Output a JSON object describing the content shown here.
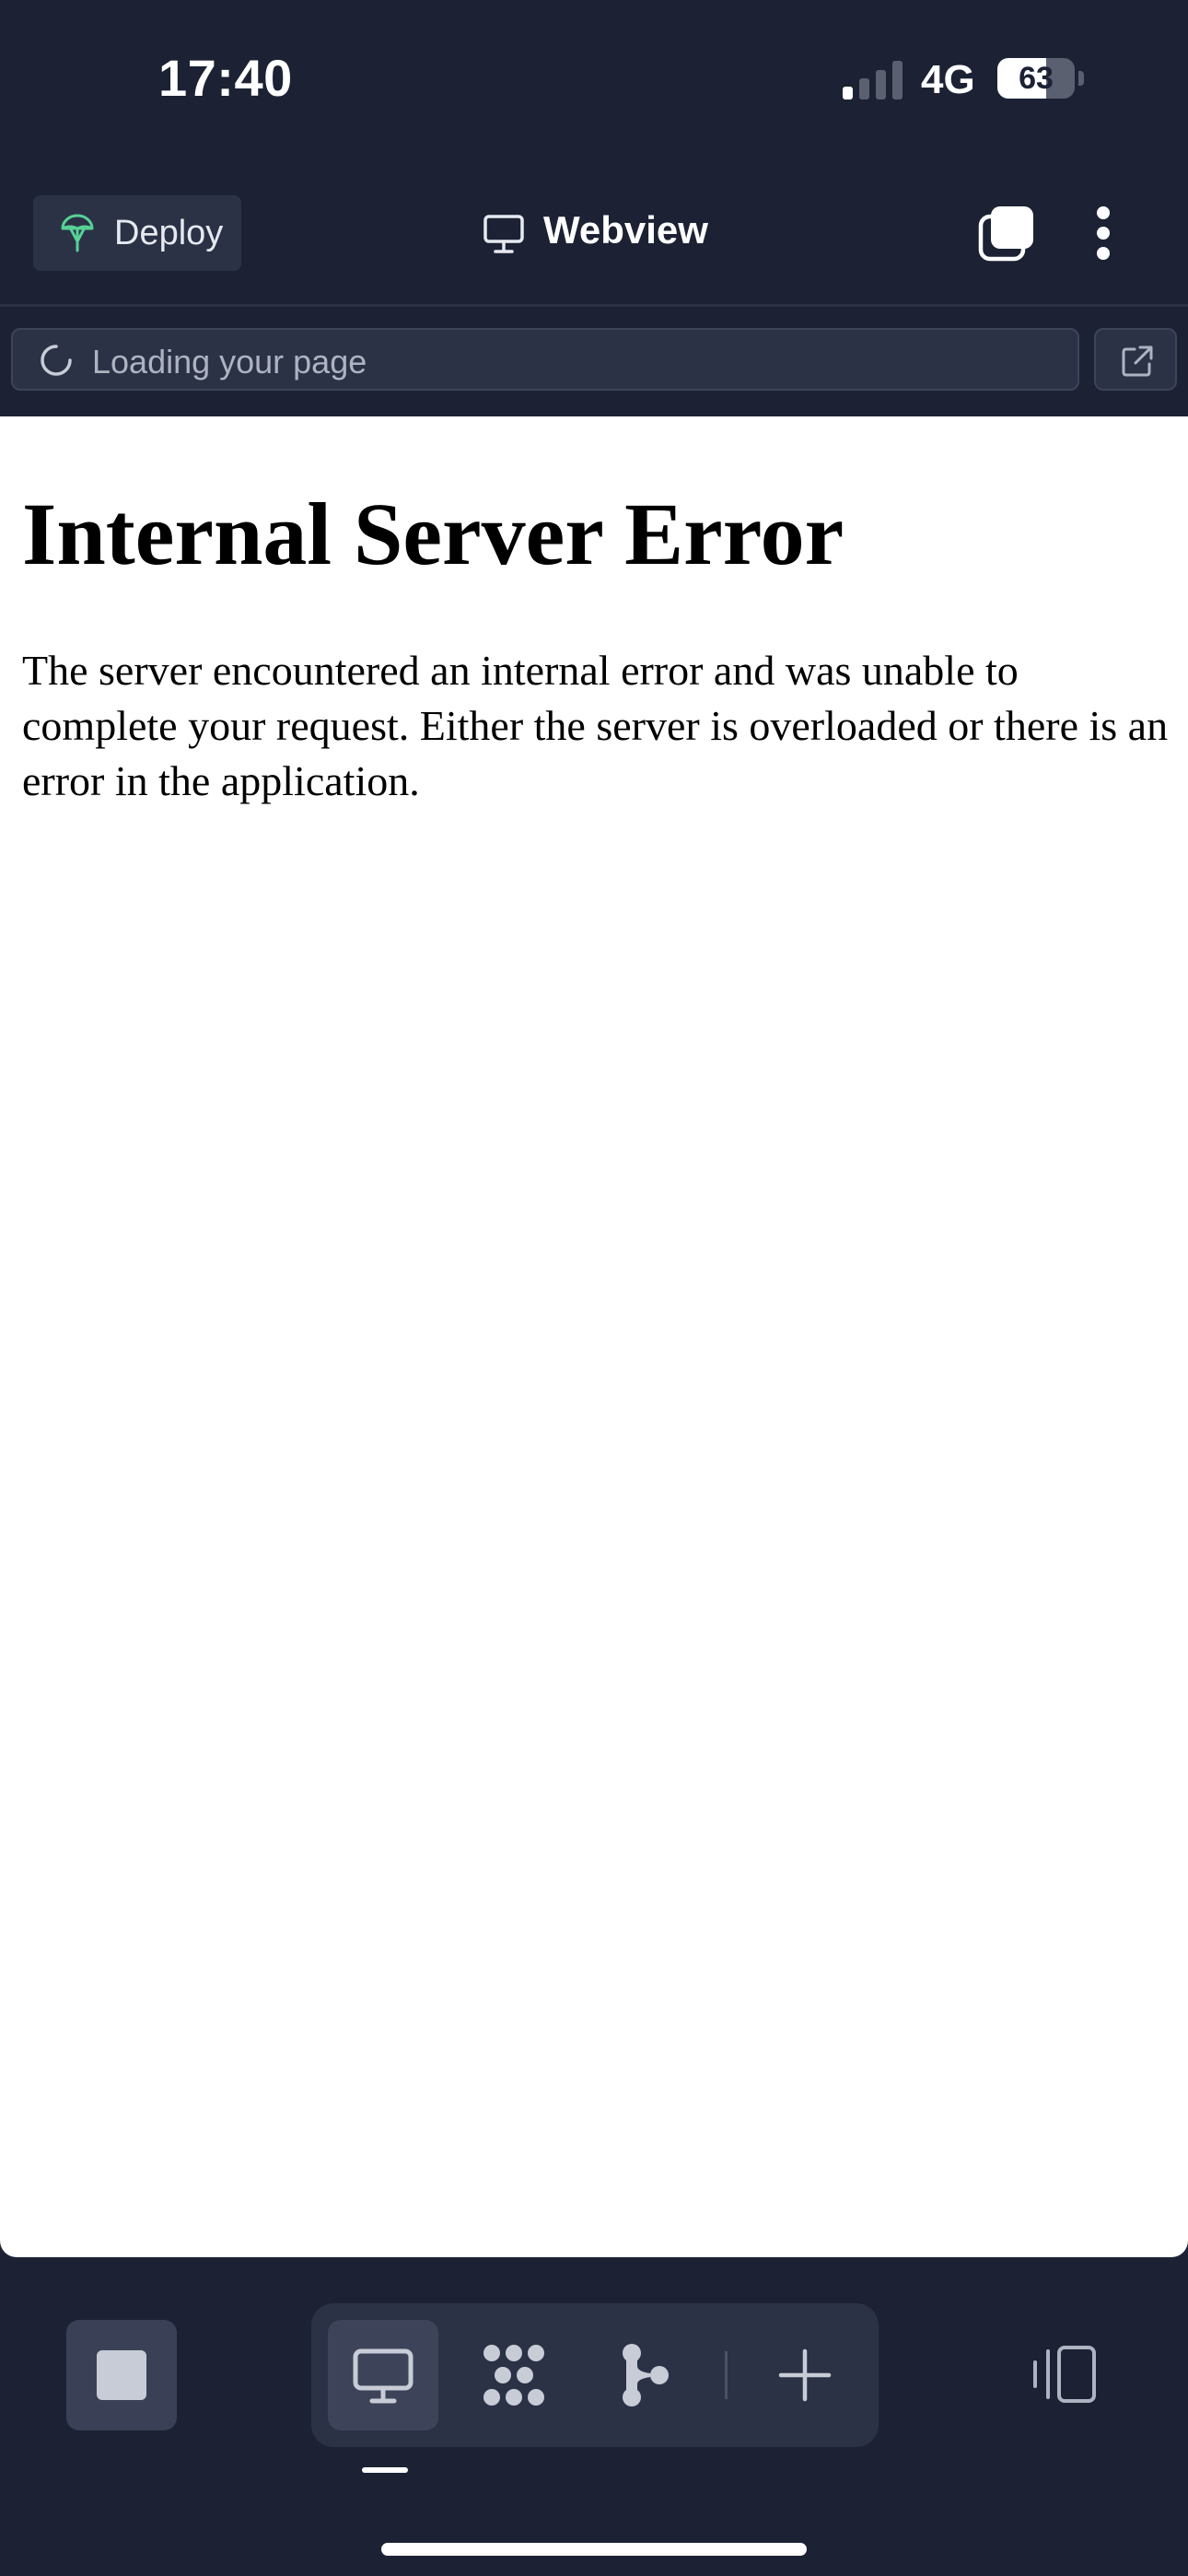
{
  "status_bar": {
    "time": "17:40",
    "network": "4G",
    "battery_percent": "63",
    "battery_level": 0.63,
    "signal_bars_active": 1,
    "signal_bars_total": 4
  },
  "toolbar": {
    "deploy_label": "Deploy",
    "deploy_icon": "parachute-icon",
    "title": "Webview",
    "title_icon": "monitor-icon",
    "tabs_icon": "tabs-icon",
    "more_icon": "more-vertical-icon"
  },
  "address_bar": {
    "text": "Loading your page",
    "status_icon": "spinner-icon",
    "external_icon": "external-link-icon"
  },
  "page": {
    "heading": "Internal Server Error",
    "body": "The server encountered an internal error and was unable to complete your request. Either the server is overloaded or there is an error in the application."
  },
  "bottom_bar": {
    "stop_icon": "stop-icon",
    "dock_items": [
      {
        "name": "webview-tab",
        "icon": "monitor-icon",
        "active": true
      },
      {
        "name": "apps-tab",
        "icon": "dots-grid-icon",
        "active": false
      },
      {
        "name": "git-tab",
        "icon": "git-branch-icon",
        "active": false
      },
      {
        "name": "add-tab",
        "icon": "plus-icon",
        "active": false
      }
    ],
    "sidepanel_icon": "side-panel-icon"
  },
  "colors": {
    "background": "#1c2234",
    "surface": "#2b3246",
    "accent_green": "#57d196",
    "text_light": "#e6e9f0",
    "page_background": "#ffffff"
  }
}
